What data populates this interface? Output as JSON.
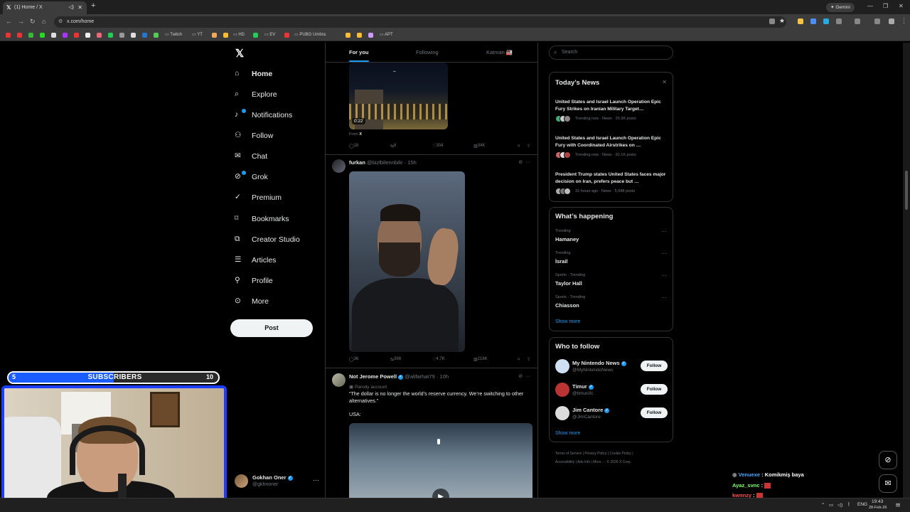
{
  "browser": {
    "tab_title": "(1) Home / X",
    "url": "x.com/home",
    "gemini_label": "Gemini",
    "bookmarks": [
      "Twitch",
      "YT",
      "HD",
      "EV",
      "PUBG Umbra",
      "APT"
    ]
  },
  "sidebar": {
    "items": [
      {
        "label": "Home",
        "icon": "home-icon"
      },
      {
        "label": "Explore",
        "icon": "search-icon"
      },
      {
        "label": "Notifications",
        "icon": "bell-icon"
      },
      {
        "label": "Follow",
        "icon": "person-add-icon"
      },
      {
        "label": "Chat",
        "icon": "mail-icon"
      },
      {
        "label": "Grok",
        "icon": "grok-icon"
      },
      {
        "label": "Premium",
        "icon": "x-premium-icon"
      },
      {
        "label": "Bookmarks",
        "icon": "bookmark-icon"
      },
      {
        "label": "Creator Studio",
        "icon": "studio-icon"
      },
      {
        "label": "Articles",
        "icon": "article-icon"
      },
      {
        "label": "Profile",
        "icon": "person-icon"
      },
      {
        "label": "More",
        "icon": "more-circle-icon"
      }
    ],
    "post_label": "Post",
    "account": {
      "name": "Gokhan Oner",
      "handle": "@gkhnoner"
    }
  },
  "timeline": {
    "tabs": [
      "For you",
      "Following",
      "Katman 🏭"
    ],
    "post1": {
      "duration": "0:22",
      "from_label": "From",
      "from_source": "X",
      "replies": "18",
      "reposts": "6",
      "likes": "304",
      "views": "34K"
    },
    "post2": {
      "name": "furkan",
      "handle": "@bizlbilennbilir",
      "time": "· 15h",
      "replies": "36",
      "reposts": "398",
      "likes": "4.7K",
      "views": "216K"
    },
    "post3": {
      "name": "Not Jerome Powell",
      "handle": "@alifarhat79",
      "time": "· 10h",
      "parody": "Parody account",
      "text": "“The dollar is no longer the world’s reserve currency. We’re switching to other alternatives.”",
      "text2": "USA:"
    }
  },
  "right": {
    "search_placeholder": "Search",
    "news_title": "Today’s News",
    "news": [
      {
        "headline": "United States and Israel Launch Operation Epic Fury Strikes on Iranian Military Target…",
        "meta": "Trending now · News · 25.3K posts"
      },
      {
        "headline": "United States and Israel Launch Operation Epic Fury with Coordinated Airstrikes on …",
        "meta": "Trending now · News · 92.1K posts"
      },
      {
        "headline": "President Trump states United States faces major decision on Iran, prefers peace but …",
        "meta": "16 hours ago · News · 5,048 posts"
      }
    ],
    "happening_title": "What’s happening",
    "trends": [
      {
        "meta": "Trending",
        "name": "Hamaney"
      },
      {
        "meta": "Trending",
        "name": "İsrail"
      },
      {
        "meta": "Sports · Trending",
        "name": "Taylor Hall"
      },
      {
        "meta": "Sports · Trending",
        "name": "Chiasson"
      }
    ],
    "show_more": "Show more",
    "wtf_title": "Who to follow",
    "wtf": [
      {
        "name": "My Nintendo News",
        "handle": "@MyNintendoNews",
        "button": "Follow"
      },
      {
        "name": "Timur",
        "handle": "@timursfc",
        "button": "Follow"
      },
      {
        "name": "Jim Cantore",
        "handle": "@JimCantore",
        "button": "Follow"
      }
    ],
    "footer": [
      "Terms of Service",
      "Privacy Policy",
      "Cookie Policy",
      "Accessibility",
      "Ads info",
      "More ···",
      "© 2026 X Corp."
    ]
  },
  "overlay": {
    "sub_current": "5",
    "sub_label": "SUBSCRIBERS",
    "sub_goal": "10",
    "sub_progress": 0.5,
    "chat": [
      {
        "user": "Venuexe",
        "msg": "Komikmiş baya",
        "color": "#4aa8ff"
      },
      {
        "user": "Ayaz_svnc",
        "msg": "",
        "color": "#7dff6a"
      },
      {
        "user": "kwnnzy",
        "msg": "",
        "color": "#ff4d4d"
      }
    ]
  },
  "taskbar": {
    "lang": "ENG",
    "time": "19:43",
    "date": "28-Feb-26"
  }
}
